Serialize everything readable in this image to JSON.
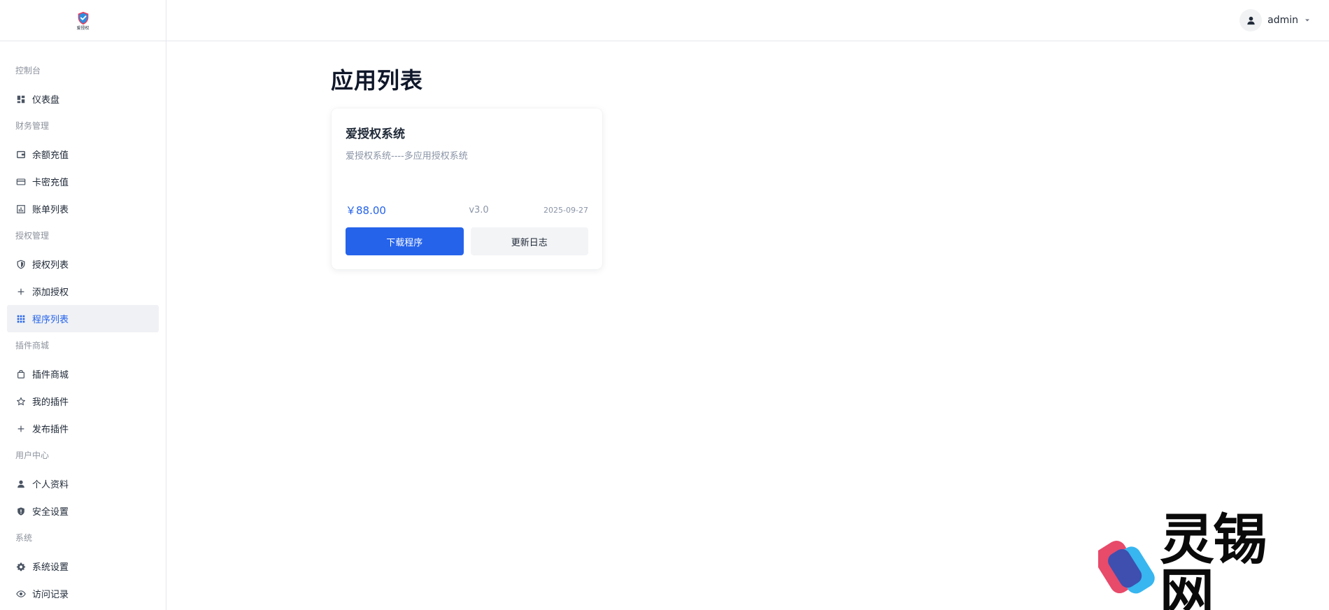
{
  "brand": {
    "logo_text": "爱授权",
    "watermark_text": "灵锡网"
  },
  "header": {
    "user_name": "admin"
  },
  "sidebar": {
    "sections": [
      {
        "title": "控制台",
        "items": [
          {
            "label": "仪表盘",
            "icon": "dashboard-icon"
          }
        ]
      },
      {
        "title": "财务管理",
        "items": [
          {
            "label": "余额充值",
            "icon": "wallet-icon"
          },
          {
            "label": "卡密充值",
            "icon": "credit-card-icon"
          },
          {
            "label": "账单列表",
            "icon": "bar-chart-icon"
          }
        ]
      },
      {
        "title": "授权管理",
        "items": [
          {
            "label": "授权列表",
            "icon": "shield-icon"
          },
          {
            "label": "添加授权",
            "icon": "plus-icon"
          },
          {
            "label": "程序列表",
            "icon": "grid-icon",
            "active": true
          }
        ]
      },
      {
        "title": "插件商城",
        "items": [
          {
            "label": "插件商城",
            "icon": "shopping-bag-icon"
          },
          {
            "label": "我的插件",
            "icon": "star-icon"
          },
          {
            "label": "发布插件",
            "icon": "plus-icon"
          }
        ]
      },
      {
        "title": "用户中心",
        "items": [
          {
            "label": "个人资料",
            "icon": "user-icon"
          },
          {
            "label": "安全设置",
            "icon": "shield-filled-icon"
          }
        ]
      },
      {
        "title": "系统",
        "items": [
          {
            "label": "系统设置",
            "icon": "gear-icon"
          },
          {
            "label": "访问记录",
            "icon": "eye-icon"
          }
        ]
      }
    ]
  },
  "main": {
    "title": "应用列表",
    "apps": [
      {
        "name": "爱授权系统",
        "description": "爱授权系统----多应用授权系统",
        "price": "￥88.00",
        "version": "v3.0",
        "date": "2025-09-27",
        "download_label": "下载程序",
        "changelog_label": "更新日志"
      }
    ]
  },
  "colors": {
    "accent": "#2563eb",
    "active_bg": "#eff1f5"
  }
}
